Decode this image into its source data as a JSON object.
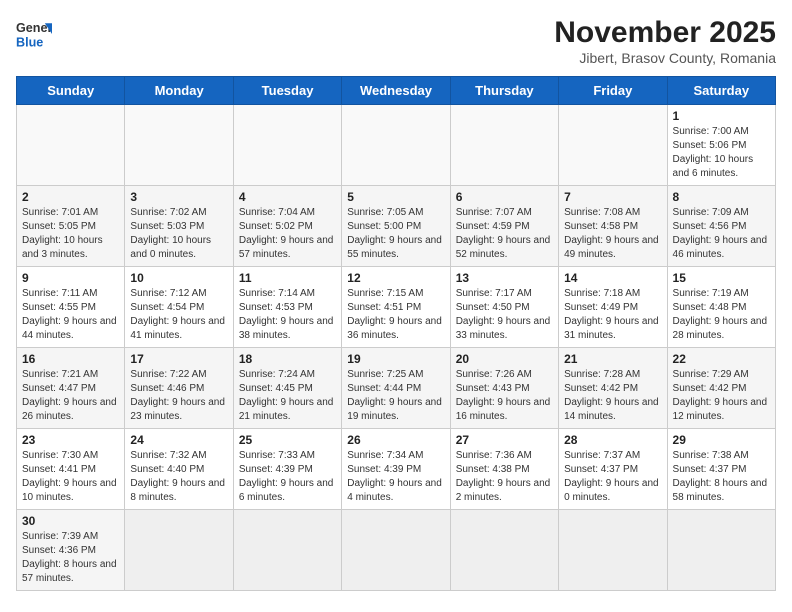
{
  "header": {
    "logo_line1": "General",
    "logo_line2": "Blue",
    "title": "November 2025",
    "subtitle": "Jibert, Brasov County, Romania"
  },
  "weekdays": [
    "Sunday",
    "Monday",
    "Tuesday",
    "Wednesday",
    "Thursday",
    "Friday",
    "Saturday"
  ],
  "weeks": [
    [
      {
        "day": "",
        "info": ""
      },
      {
        "day": "",
        "info": ""
      },
      {
        "day": "",
        "info": ""
      },
      {
        "day": "",
        "info": ""
      },
      {
        "day": "",
        "info": ""
      },
      {
        "day": "",
        "info": ""
      },
      {
        "day": "1",
        "info": "Sunrise: 7:00 AM\nSunset: 5:06 PM\nDaylight: 10 hours and 6 minutes."
      }
    ],
    [
      {
        "day": "2",
        "info": "Sunrise: 7:01 AM\nSunset: 5:05 PM\nDaylight: 10 hours and 3 minutes."
      },
      {
        "day": "3",
        "info": "Sunrise: 7:02 AM\nSunset: 5:03 PM\nDaylight: 10 hours and 0 minutes."
      },
      {
        "day": "4",
        "info": "Sunrise: 7:04 AM\nSunset: 5:02 PM\nDaylight: 9 hours and 57 minutes."
      },
      {
        "day": "5",
        "info": "Sunrise: 7:05 AM\nSunset: 5:00 PM\nDaylight: 9 hours and 55 minutes."
      },
      {
        "day": "6",
        "info": "Sunrise: 7:07 AM\nSunset: 4:59 PM\nDaylight: 9 hours and 52 minutes."
      },
      {
        "day": "7",
        "info": "Sunrise: 7:08 AM\nSunset: 4:58 PM\nDaylight: 9 hours and 49 minutes."
      },
      {
        "day": "8",
        "info": "Sunrise: 7:09 AM\nSunset: 4:56 PM\nDaylight: 9 hours and 46 minutes."
      }
    ],
    [
      {
        "day": "9",
        "info": "Sunrise: 7:11 AM\nSunset: 4:55 PM\nDaylight: 9 hours and 44 minutes."
      },
      {
        "day": "10",
        "info": "Sunrise: 7:12 AM\nSunset: 4:54 PM\nDaylight: 9 hours and 41 minutes."
      },
      {
        "day": "11",
        "info": "Sunrise: 7:14 AM\nSunset: 4:53 PM\nDaylight: 9 hours and 38 minutes."
      },
      {
        "day": "12",
        "info": "Sunrise: 7:15 AM\nSunset: 4:51 PM\nDaylight: 9 hours and 36 minutes."
      },
      {
        "day": "13",
        "info": "Sunrise: 7:17 AM\nSunset: 4:50 PM\nDaylight: 9 hours and 33 minutes."
      },
      {
        "day": "14",
        "info": "Sunrise: 7:18 AM\nSunset: 4:49 PM\nDaylight: 9 hours and 31 minutes."
      },
      {
        "day": "15",
        "info": "Sunrise: 7:19 AM\nSunset: 4:48 PM\nDaylight: 9 hours and 28 minutes."
      }
    ],
    [
      {
        "day": "16",
        "info": "Sunrise: 7:21 AM\nSunset: 4:47 PM\nDaylight: 9 hours and 26 minutes."
      },
      {
        "day": "17",
        "info": "Sunrise: 7:22 AM\nSunset: 4:46 PM\nDaylight: 9 hours and 23 minutes."
      },
      {
        "day": "18",
        "info": "Sunrise: 7:24 AM\nSunset: 4:45 PM\nDaylight: 9 hours and 21 minutes."
      },
      {
        "day": "19",
        "info": "Sunrise: 7:25 AM\nSunset: 4:44 PM\nDaylight: 9 hours and 19 minutes."
      },
      {
        "day": "20",
        "info": "Sunrise: 7:26 AM\nSunset: 4:43 PM\nDaylight: 9 hours and 16 minutes."
      },
      {
        "day": "21",
        "info": "Sunrise: 7:28 AM\nSunset: 4:42 PM\nDaylight: 9 hours and 14 minutes."
      },
      {
        "day": "22",
        "info": "Sunrise: 7:29 AM\nSunset: 4:42 PM\nDaylight: 9 hours and 12 minutes."
      }
    ],
    [
      {
        "day": "23",
        "info": "Sunrise: 7:30 AM\nSunset: 4:41 PM\nDaylight: 9 hours and 10 minutes."
      },
      {
        "day": "24",
        "info": "Sunrise: 7:32 AM\nSunset: 4:40 PM\nDaylight: 9 hours and 8 minutes."
      },
      {
        "day": "25",
        "info": "Sunrise: 7:33 AM\nSunset: 4:39 PM\nDaylight: 9 hours and 6 minutes."
      },
      {
        "day": "26",
        "info": "Sunrise: 7:34 AM\nSunset: 4:39 PM\nDaylight: 9 hours and 4 minutes."
      },
      {
        "day": "27",
        "info": "Sunrise: 7:36 AM\nSunset: 4:38 PM\nDaylight: 9 hours and 2 minutes."
      },
      {
        "day": "28",
        "info": "Sunrise: 7:37 AM\nSunset: 4:37 PM\nDaylight: 9 hours and 0 minutes."
      },
      {
        "day": "29",
        "info": "Sunrise: 7:38 AM\nSunset: 4:37 PM\nDaylight: 8 hours and 58 minutes."
      }
    ],
    [
      {
        "day": "30",
        "info": "Sunrise: 7:39 AM\nSunset: 4:36 PM\nDaylight: 8 hours and 57 minutes."
      },
      {
        "day": "",
        "info": ""
      },
      {
        "day": "",
        "info": ""
      },
      {
        "day": "",
        "info": ""
      },
      {
        "day": "",
        "info": ""
      },
      {
        "day": "",
        "info": ""
      },
      {
        "day": "",
        "info": ""
      }
    ]
  ]
}
